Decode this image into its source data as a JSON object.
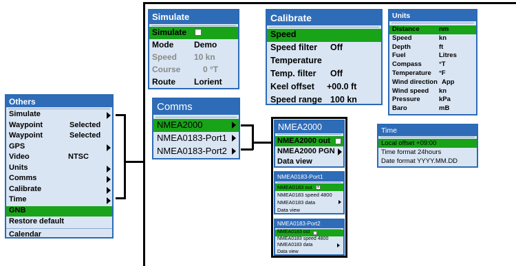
{
  "others": {
    "title": "Others",
    "items": [
      {
        "label": "Simulate",
        "value": "",
        "arrow": true
      },
      {
        "label": "Waypoint",
        "value": "Selected",
        "arrow": false
      },
      {
        "label": "Waypoint",
        "value": "Selected",
        "arrow": false
      },
      {
        "label": "GPS",
        "value": "",
        "arrow": true
      },
      {
        "label": "Video",
        "value": "NTSC",
        "arrow": false
      },
      {
        "label": "Units",
        "value": "",
        "arrow": true
      },
      {
        "label": "Comms",
        "value": "",
        "arrow": true
      },
      {
        "label": "Calibrate",
        "value": "",
        "arrow": true
      },
      {
        "label": "Time",
        "value": "",
        "arrow": true
      },
      {
        "label": "GNB",
        "value": "",
        "arrow": false,
        "selected": true
      },
      {
        "label": "Restore default",
        "value": "",
        "arrow": false
      },
      {
        "label": "Calendar",
        "value": "",
        "arrow": false
      }
    ]
  },
  "simulate": {
    "title": "Simulate",
    "items": [
      {
        "label": "Simulate",
        "value": "",
        "checkbox": true,
        "selected": true
      },
      {
        "label": "Mode",
        "value": "Demo"
      },
      {
        "label": "Speed",
        "value": "10  kn",
        "dim": true
      },
      {
        "label": "Course",
        "value": "0  °T",
        "dim": true
      },
      {
        "label": "Route",
        "value": "Lorient"
      }
    ]
  },
  "calibrate": {
    "title": "Calibrate",
    "items": [
      {
        "label": "Speed",
        "value": "",
        "selected": true
      },
      {
        "label": "Speed  filter",
        "value": "Off"
      },
      {
        "label": "Temperature",
        "value": ""
      },
      {
        "label": "Temp.  filter",
        "value": "Off"
      },
      {
        "label": "Keel  offset",
        "value": "+00.0  ft"
      },
      {
        "label": "Speed  range",
        "value": "100  kn"
      }
    ]
  },
  "units": {
    "title": "Units",
    "items": [
      {
        "label": "Distance",
        "value": "nm",
        "selected": true
      },
      {
        "label": "Speed",
        "value": "kn"
      },
      {
        "label": "Depth",
        "value": "ft"
      },
      {
        "label": "Fuel",
        "value": "Litres"
      },
      {
        "label": "Compass",
        "value": "°T"
      },
      {
        "label": "Temperature",
        "value": "°F"
      },
      {
        "label": "Wind direction",
        "value": "App"
      },
      {
        "label": "Wind speed",
        "value": "kn"
      },
      {
        "label": "Pressure",
        "value": "kPa"
      },
      {
        "label": "Baro",
        "value": "mB"
      }
    ]
  },
  "comms": {
    "title": "Comms",
    "items": [
      {
        "label": "NMEA2000",
        "selected": true
      },
      {
        "label": "NMEA0183-Port1"
      },
      {
        "label": "NMEA0183-Port2"
      }
    ]
  },
  "nmea2000": {
    "title": "NMEA2000",
    "items": [
      {
        "label": "NMEA2000  out",
        "checkbox": true,
        "selected": true
      },
      {
        "label": "NMEA2000  PGN",
        "arrow": true
      },
      {
        "label": "Data  view"
      }
    ]
  },
  "port1": {
    "title": "NMEA0183-Port1",
    "items": [
      {
        "label": "NMEA0183  out",
        "checkbox": "x",
        "selected": true
      },
      {
        "label": "NMEA0183  speed  4800"
      },
      {
        "label": "NMEA0183  data",
        "arrow": true
      },
      {
        "label": "Data  view"
      }
    ]
  },
  "port2": {
    "title": "NMEA0183-Port2",
    "items": [
      {
        "label": "NMEA0183  out",
        "checkbox": true,
        "selected": true
      },
      {
        "label": "NMEA0183  speed  4800"
      },
      {
        "label": "NMEA0183  data",
        "arrow": true
      },
      {
        "label": "Data  view"
      }
    ]
  },
  "time": {
    "title": "Time",
    "items": [
      {
        "label": "Local  offset  +09:00",
        "selected": true
      },
      {
        "label": "Time  format  24hours"
      },
      {
        "label": "Date  format  YYYY.MM.DD"
      }
    ]
  }
}
